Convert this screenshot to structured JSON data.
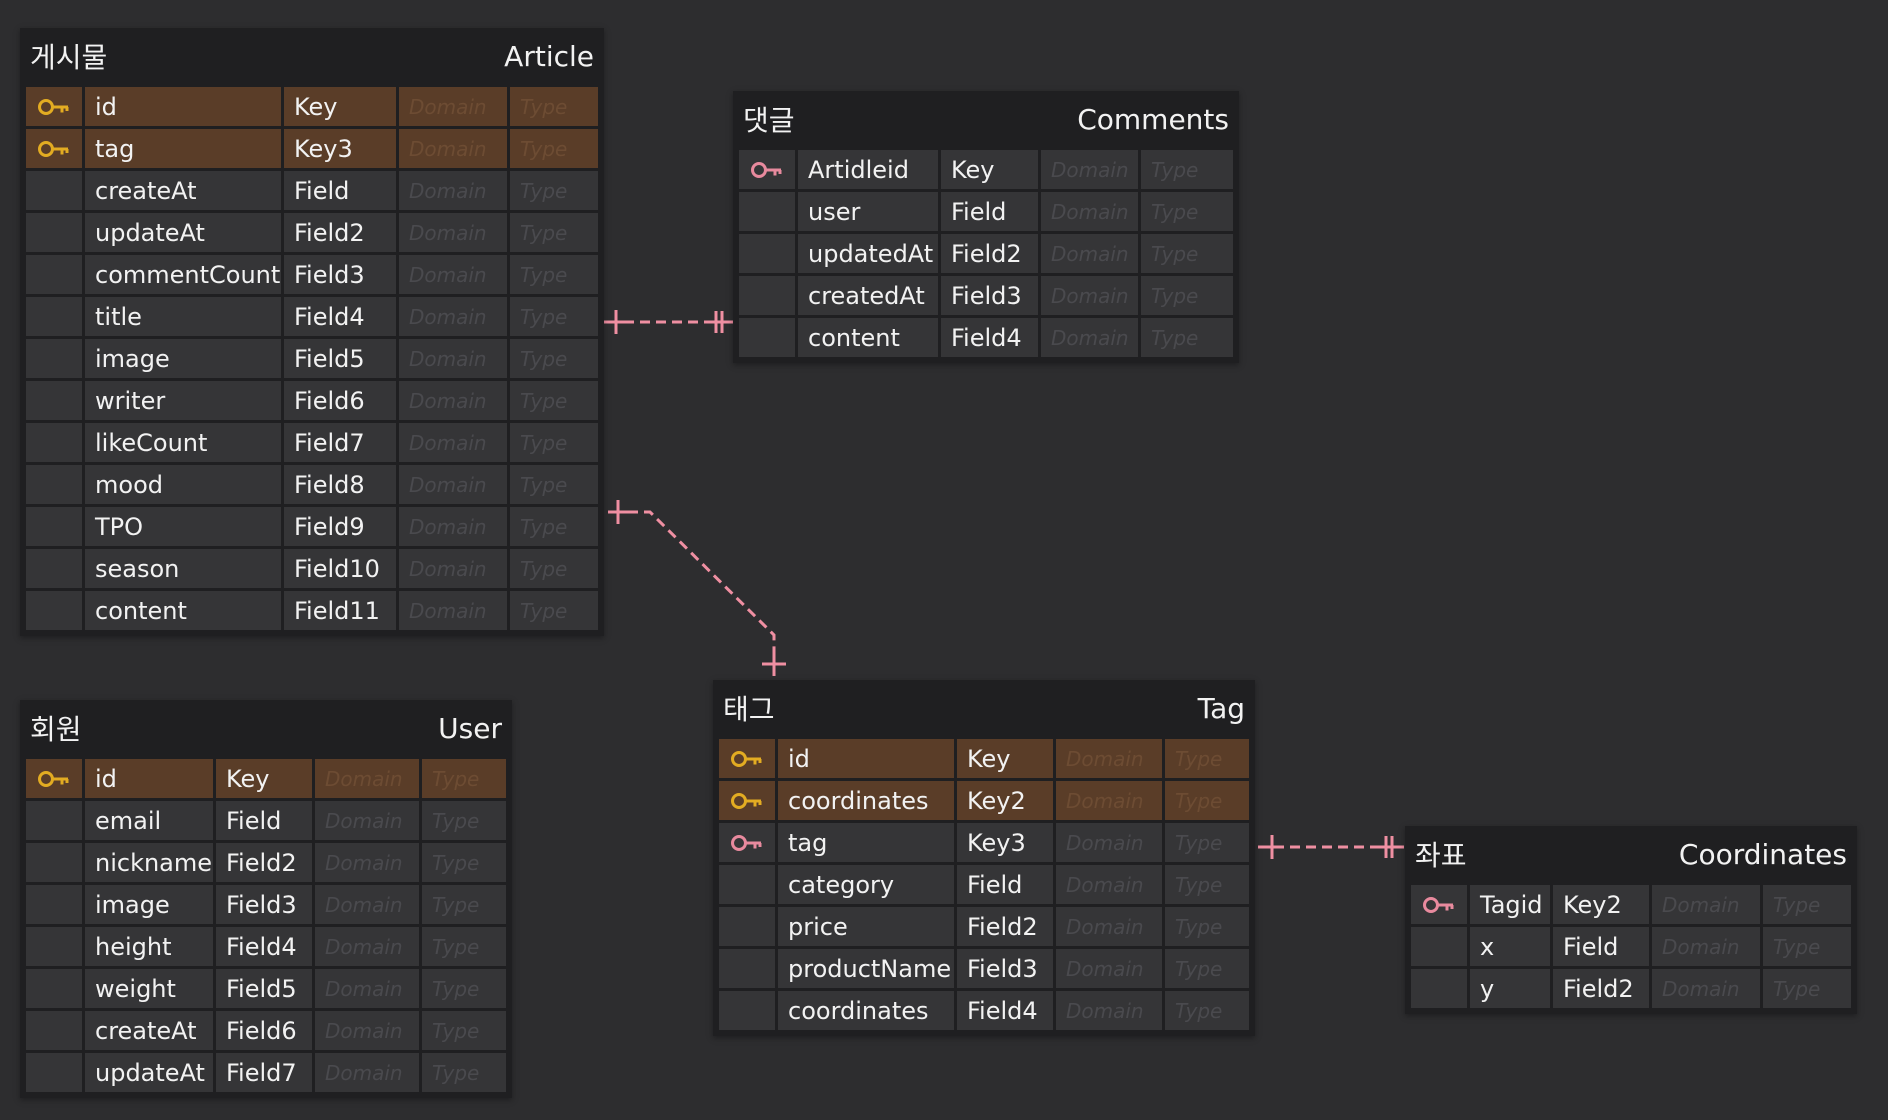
{
  "colors": {
    "background": "#2d2d2f",
    "table_bg": "#1f1f21",
    "cell_bg": "#353537",
    "pk_cell_bg": "#5a3d28",
    "key_icon_pk": "#e3ac22",
    "key_icon_fk": "#e88a9e",
    "relation_line": "#ef8fa2"
  },
  "placeholders": {
    "domain": "Domain",
    "type": "Type"
  },
  "entities": {
    "article": {
      "logical": "게시물",
      "physical": "Article",
      "columns": [
        {
          "name": "id",
          "field": "Key",
          "key": "pk"
        },
        {
          "name": "tag",
          "field": "Key3",
          "key": "pk"
        },
        {
          "name": "createAt",
          "field": "Field",
          "key": "none"
        },
        {
          "name": "updateAt",
          "field": "Field2",
          "key": "none"
        },
        {
          "name": "commentCount",
          "field": "Field3",
          "key": "none"
        },
        {
          "name": "title",
          "field": "Field4",
          "key": "none"
        },
        {
          "name": "image",
          "field": "Field5",
          "key": "none"
        },
        {
          "name": "writer",
          "field": "Field6",
          "key": "none"
        },
        {
          "name": "likeCount",
          "field": "Field7",
          "key": "none"
        },
        {
          "name": "mood",
          "field": "Field8",
          "key": "none"
        },
        {
          "name": "TPO",
          "field": "Field9",
          "key": "none"
        },
        {
          "name": "season",
          "field": "Field10",
          "key": "none"
        },
        {
          "name": "content",
          "field": "Field11",
          "key": "none"
        }
      ]
    },
    "comments": {
      "logical": "댓글",
      "physical": "Comments",
      "columns": [
        {
          "name": "Artidleid",
          "field": "Key",
          "key": "fk"
        },
        {
          "name": "user",
          "field": "Field",
          "key": "none"
        },
        {
          "name": "updatedAt",
          "field": "Field2",
          "key": "none"
        },
        {
          "name": "createdAt",
          "field": "Field3",
          "key": "none"
        },
        {
          "name": "content",
          "field": "Field4",
          "key": "none"
        }
      ]
    },
    "user": {
      "logical": "회원",
      "physical": "User",
      "columns": [
        {
          "name": "id",
          "field": "Key",
          "key": "pk"
        },
        {
          "name": "email",
          "field": "Field",
          "key": "none"
        },
        {
          "name": "nickname",
          "field": "Field2",
          "key": "none"
        },
        {
          "name": "image",
          "field": "Field3",
          "key": "none"
        },
        {
          "name": "height",
          "field": "Field4",
          "key": "none"
        },
        {
          "name": "weight",
          "field": "Field5",
          "key": "none"
        },
        {
          "name": "createAt",
          "field": "Field6",
          "key": "none"
        },
        {
          "name": "updateAt",
          "field": "Field7",
          "key": "none"
        }
      ]
    },
    "tag": {
      "logical": "태그",
      "physical": "Tag",
      "columns": [
        {
          "name": "id",
          "field": "Key",
          "key": "pk"
        },
        {
          "name": "coordinates",
          "field": "Key2",
          "key": "pk"
        },
        {
          "name": "tag",
          "field": "Key3",
          "key": "fk"
        },
        {
          "name": "category",
          "field": "Field",
          "key": "none"
        },
        {
          "name": "price",
          "field": "Field2",
          "key": "none"
        },
        {
          "name": "productName",
          "field": "Field3",
          "key": "none"
        },
        {
          "name": "coordinates",
          "field": "Field4",
          "key": "none"
        }
      ]
    },
    "coordinates": {
      "logical": "좌표",
      "physical": "Coordinates",
      "columns": [
        {
          "name": "Tagid",
          "field": "Key2",
          "key": "fk"
        },
        {
          "name": "x",
          "field": "Field",
          "key": "none"
        },
        {
          "name": "y",
          "field": "Field2",
          "key": "none"
        }
      ]
    }
  }
}
